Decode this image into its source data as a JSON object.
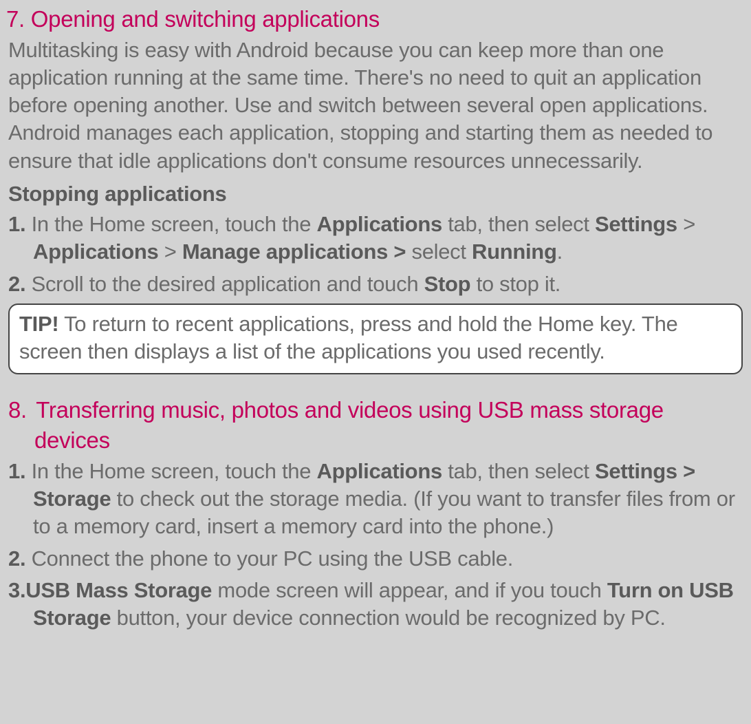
{
  "section7": {
    "heading": "7. Opening and switching applications",
    "body": "Multitasking is easy with Android because you can keep more than one application running at the same time. There's no need to quit an application before opening another. Use and switch between several open applications. Android manages each application, stopping and starting them as needed to ensure that idle applications don't consume resources unnecessarily.",
    "subheading": "Stopping applications",
    "steps": [
      {
        "marker": "1.",
        "pre": " In the Home screen, touch the ",
        "b1": "Applications",
        "mid1": " tab, then select ",
        "b2": "Settings",
        "mid2": " > ",
        "b3": "Applications",
        "mid3": " > ",
        "b4": "Manage applications >",
        "mid4": " select ",
        "b5": "Running",
        "post": "."
      },
      {
        "marker": "2.",
        "pre": " Scroll to the desired application and touch ",
        "b1": "Stop",
        "post": " to stop it."
      }
    ],
    "tip": {
      "label": "TIP!",
      "text": " To return to recent applications, press and hold the Home key. The screen then displays a list of the applications you used recently."
    }
  },
  "section8": {
    "heading_num": "8.",
    "heading_text": " Transferring music, photos and videos using USB mass storage devices",
    "steps": [
      {
        "marker": "1.",
        "pre": " In the Home screen, touch the ",
        "b1": "Applications",
        "mid1": " tab, then select ",
        "b2": "Settings > Storage",
        "post": " to check out the storage media. (If you want to transfer files from or to a memory card, insert a memory card into the phone.)"
      },
      {
        "marker": "2.",
        "text": " Connect the phone to your PC using the USB cable."
      },
      {
        "marker": "3.",
        "b1": "USB Mass Storage",
        "mid1": " mode screen will appear, and if you touch ",
        "b2": "Turn on USB Storage",
        "post": " button, your device connection would be recognized by PC."
      }
    ]
  }
}
